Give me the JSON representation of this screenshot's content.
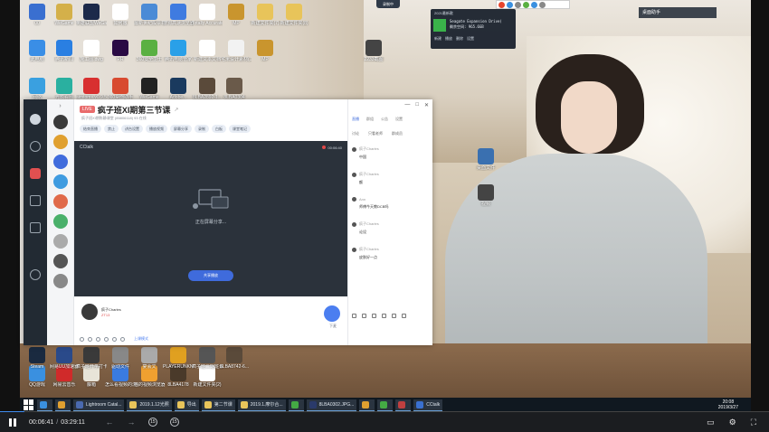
{
  "desktop": {
    "icons": [
      {
        "label": "00",
        "color": "#3a6fd0"
      },
      {
        "label": "WeGame",
        "color": "#d4b04a"
      },
      {
        "label": "英雄联盟WeGame版",
        "color": "#1c2a4a"
      },
      {
        "label": "如何撒",
        "color": "#ffffff"
      },
      {
        "label": "最新世纪般票打折列表(...",
        "color": "#4b8bd6"
      },
      {
        "label": "搜狗高速浏览器",
        "color": "#3f7be0"
      },
      {
        "label": "Totally Accurate B...",
        "color": "#ffffff"
      },
      {
        "label": "MP",
        "color": "#c9952e"
      },
      {
        "label": "新建文件夹(7)",
        "color": "#e8c45a"
      },
      {
        "label": "新建文件夹(8)",
        "color": "#e8c45a"
      },
      {
        "label": "此电脑",
        "color": "#3a8ee6"
      },
      {
        "label": "腾讯新闻",
        "color": "#2a7fe2"
      },
      {
        "label": "施工图.dwg",
        "color": "#ffffff"
      },
      {
        "label": "PR",
        "color": "#2a0a44"
      },
      {
        "label": "360安全卫士",
        "color": "#5ab042"
      },
      {
        "label": "腾讯电脑管家",
        "color": "#2aa0e8"
      },
      {
        "label": "新建文本文档",
        "color": "#ffffff"
      },
      {
        "label": "宅米设计素材(二)",
        "color": "#f2f2f2"
      },
      {
        "label": "MP",
        "color": "#c9952e"
      },
      {
        "label": "网络",
        "color": "#3aa0e0"
      },
      {
        "label": "光影看图",
        "color": "#2ab0a0"
      },
      {
        "label": "aimtoms.v0.9.5",
        "color": "#d83030"
      },
      {
        "label": "360桌面助手",
        "color": "#d84a30"
      },
      {
        "label": "WeGame",
        "color": "#222222"
      },
      {
        "label": "Adobe...",
        "color": "#1a3a5e"
      },
      {
        "label": "8LBA2892-1...",
        "color": "#5a4a3a"
      },
      {
        "label": "8LBA0304",
        "color": "#6a5a4a"
      },
      {
        "label": "2233截图",
        "color": "#444444"
      },
      {
        "label": "QQ游戏",
        "color": "#3a90e0"
      },
      {
        "label": "网易云音乐",
        "color": "#d02a2a"
      },
      {
        "label": "藤箱",
        "color": "#e8e4d8"
      },
      {
        "label": "怎么看视频的浏览器",
        "color": "#3a7be0"
      },
      {
        "label": "猫的视频浏览器",
        "color": "#f0a030"
      },
      {
        "label": "8LBA4178",
        "color": "#4a3a2a"
      },
      {
        "label": "新建文件夹(2)",
        "color": "#ffffff"
      },
      {
        "label": "Steam",
        "color": "#1a2a40"
      },
      {
        "label": "网易UU加速器",
        "color": "#2a4a8a"
      },
      {
        "label": "疯子班开学打卡",
        "color": "#3a3a3a"
      },
      {
        "label": "驱动文件",
        "color": "#888888"
      },
      {
        "label": "宴会文",
        "color": "#aaaaaa"
      },
      {
        "label": "PLAYERUNKNOWN'S...",
        "color": "#e0a020"
      },
      {
        "label": "疯子班三期班设计&Intern...",
        "color": "#555555"
      },
      {
        "label": "8LBA8742-6...",
        "color": "#5a4a3a"
      },
      {
        "label": "桌面文件",
        "color": "#3a70b0"
      },
      {
        "label": "视频",
        "color": "#444444"
      }
    ]
  },
  "tray": {
    "recorder_label": "录制中",
    "ime_label": "S中",
    "notify_label": "桌面助手"
  },
  "mini_panel": {
    "title": "2021最新歌",
    "line1": "Seagate Expansion Drive(",
    "line2": "剩余空间: 965.6GB",
    "actions": [
      "新建",
      "播放",
      "删除",
      "设置"
    ]
  },
  "cctalk": {
    "badge": "LIVE",
    "title": "疯子班XI期第三节课",
    "subtitle": "疯子班XI期陈静课堂 (85806118)  93 在线",
    "toolbar": [
      "结束直播",
      "禁止",
      "讲台设置",
      "播放视频",
      "屏幕分享",
      "录制",
      "白板",
      "课堂笔记"
    ],
    "brand": "CCtalk",
    "timer": "00:06:40",
    "share_text": "正在屏幕分享...",
    "share_button": "共享播放",
    "teacher_name": "疯子Charles",
    "teacher_meta": "ZT13",
    "mic_label": "下麦",
    "tools_label": "上课模式",
    "window_buttons": [
      "—",
      "□",
      "✕"
    ],
    "right_tabs": [
      "直播",
      "群组",
      "公告",
      "设置"
    ],
    "right_sub": [
      "讨论",
      "只看老师",
      "群成员"
    ],
    "messages": [
      {
        "name": "疯子Charles",
        "text": "中国"
      },
      {
        "name": "疯子Charles",
        "text": "额"
      },
      {
        "name": "Ann",
        "text": "师傅今天教DCB吗"
      },
      {
        "name": "疯子Charles",
        "text": "论设"
      },
      {
        "name": "疯子Charles",
        "text": "皮肤好一点"
      }
    ]
  },
  "taskbar": {
    "items": [
      {
        "label": "",
        "color": "#3a90e0"
      },
      {
        "label": "",
        "color": "#e0a030"
      },
      {
        "label": "Lightroom Catal...",
        "color": "#4a6ab0"
      },
      {
        "label": "2019.1.12光照",
        "color": "#e8c45a"
      },
      {
        "label": "导出",
        "color": "#e8c45a"
      },
      {
        "label": "第二节课",
        "color": "#e8c45a"
      },
      {
        "label": "2019.1.摩尔合...",
        "color": "#e8c45a"
      },
      {
        "label": "",
        "color": "#44aa44"
      },
      {
        "label": "8LBA0302.JPG...",
        "color": "#2a3a6a"
      },
      {
        "label": "",
        "color": "#e0a030"
      },
      {
        "label": "",
        "color": "#44aa44"
      },
      {
        "label": "",
        "color": "#c04040"
      },
      {
        "label": "CCtalk",
        "color": "#3a70d0"
      }
    ],
    "clock_time": "20:08",
    "clock_date": "2019/3/27"
  },
  "player": {
    "current_time": "00:06:41",
    "separator": "/",
    "total_time": "03:29:11",
    "rewind_label": "15",
    "forward_label": "15",
    "progress": 0.032,
    "accent": "#3f8cf0"
  }
}
